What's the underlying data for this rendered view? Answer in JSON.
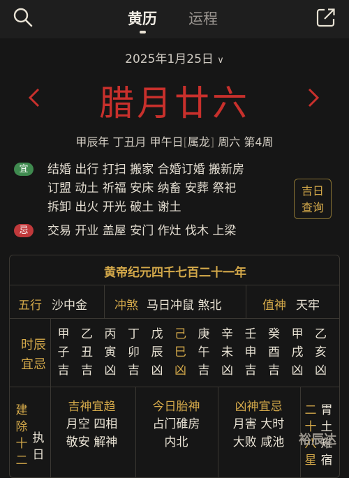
{
  "header": {
    "tabs": [
      "黄历",
      "运程"
    ],
    "active_tab": 0,
    "icons": [
      "search-icon",
      "share-icon"
    ]
  },
  "date": {
    "solar": "2025年1月25日",
    "lunar": "腊月廿六",
    "ganzhi_year": "甲辰年",
    "ganzhi_month": "丁丑月",
    "ganzhi_day": "甲午日",
    "zodiac": "属龙",
    "weekday": "周六",
    "week": "第4周"
  },
  "yi": {
    "badge": "宜",
    "lines": [
      "结婚 出行 打扫 搬家 合婚订婚 搬新房",
      "订盟 动土 祈福 安床 纳畜 安葬 祭祀",
      "拆卸 出火 开光 破土 谢土"
    ]
  },
  "ji": {
    "badge": "忌",
    "lines": [
      "交易 开业 盖屋 安门 作灶 伐木 上梁"
    ]
  },
  "jiri_button": [
    "吉日",
    "查询"
  ],
  "almanac": {
    "era": "黄帝纪元四千七百二十一年",
    "wuxing_label": "五行",
    "wuxing_value": "沙中金",
    "chongsha_label": "冲煞",
    "chongsha_value": "马日冲鼠 煞北",
    "zhishen_label": "值神",
    "zhishen_value": "天牢",
    "shichen_label": [
      "时辰",
      "宜忌"
    ],
    "hours": [
      {
        "gan": "甲",
        "zhi": "子",
        "luck": "吉"
      },
      {
        "gan": "乙",
        "zhi": "丑",
        "luck": "吉"
      },
      {
        "gan": "丙",
        "zhi": "寅",
        "luck": "凶"
      },
      {
        "gan": "丁",
        "zhi": "卯",
        "luck": "吉"
      },
      {
        "gan": "戊",
        "zhi": "辰",
        "luck": "凶"
      },
      {
        "gan": "己",
        "zhi": "巳",
        "luck": "凶"
      },
      {
        "gan": "庚",
        "zhi": "午",
        "luck": "吉"
      },
      {
        "gan": "辛",
        "zhi": "未",
        "luck": "凶"
      },
      {
        "gan": "壬",
        "zhi": "申",
        "luck": "吉"
      },
      {
        "gan": "癸",
        "zhi": "酉",
        "luck": "吉"
      },
      {
        "gan": "甲",
        "zhi": "戌",
        "luck": "凶"
      },
      {
        "gan": "乙",
        "zhi": "亥",
        "luck": "凶"
      }
    ],
    "current_hour_index": 5,
    "jianchu_label": "建除十二",
    "jianchu_value": "执日",
    "jishen_label": "吉神宜趋",
    "jishen_lines": [
      "月空 四相",
      "敬安 解神"
    ],
    "taishen_label": "今日胎神",
    "taishen_lines": [
      "占门碓房",
      "内北"
    ],
    "xiongshen_label": "凶神宜忌",
    "xiongshen_lines": [
      "月害 大时",
      "大败 咸池"
    ],
    "xiu_label": "二十八星",
    "xiu_value": "胃土雉宿"
  },
  "watermark": "裕辰达"
}
